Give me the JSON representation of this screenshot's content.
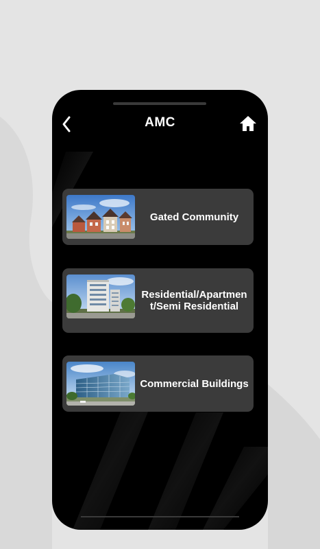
{
  "header": {
    "title": "AMC",
    "back_icon": "chevron-left-icon",
    "home_icon": "home-icon"
  },
  "categories": [
    {
      "label": "Gated Community",
      "image": "townhouse-row-photo"
    },
    {
      "label": "Residential/Apartment/Semi Residential",
      "image": "apartment-building-photo"
    },
    {
      "label": "Commercial Buildings",
      "image": "glass-office-building-photo"
    }
  ],
  "colors": {
    "page_background": "#e4e4e4",
    "phone_background": "#000000",
    "card_background": "#3b3b3b",
    "text": "#ffffff"
  }
}
